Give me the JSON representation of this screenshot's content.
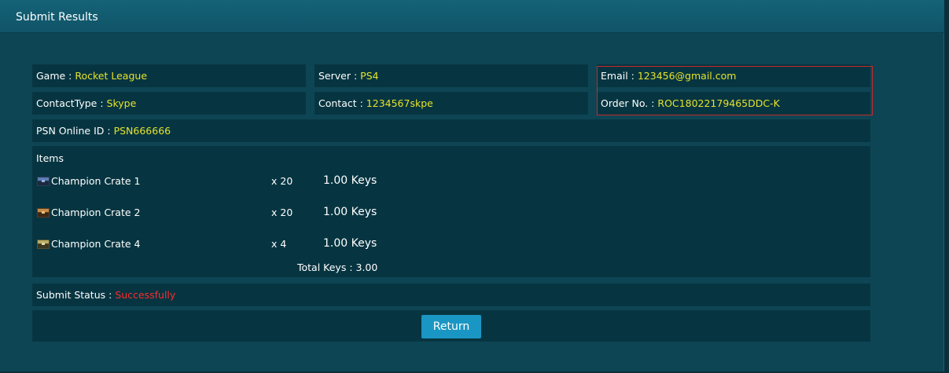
{
  "header": {
    "title": "Submit Results"
  },
  "fields": {
    "game": {
      "label": "Game : ",
      "value": "Rocket League"
    },
    "server": {
      "label": "Server : ",
      "value": "PS4"
    },
    "email": {
      "label": "Email : ",
      "value": "123456@gmail.com"
    },
    "contact_type": {
      "label": "ContactType : ",
      "value": "Skype"
    },
    "contact": {
      "label": "Contact : ",
      "value": "1234567skpe"
    },
    "order_no": {
      "label": "Order No. : ",
      "value": "ROC18022179465DDC-K"
    },
    "psn_id": {
      "label": "PSN Online ID : ",
      "value": "PSN666666"
    }
  },
  "items": {
    "title": "Items",
    "list": [
      {
        "name": "Champion Crate 1",
        "qty": "x 20",
        "price": "1.00 Keys",
        "icon": "crate-1-icon"
      },
      {
        "name": "Champion Crate 2",
        "qty": "x 20",
        "price": "1.00 Keys",
        "icon": "crate-2-icon"
      },
      {
        "name": "Champion Crate 4",
        "qty": "x 4",
        "price": "1.00 Keys",
        "icon": "crate-4-icon"
      }
    ],
    "total": "Total Keys : 3.00"
  },
  "status": {
    "label": "Submit Status : ",
    "value": "Successfully"
  },
  "actions": {
    "return_label": "Return"
  },
  "colors": {
    "value": "#e6e22c",
    "status": "#ff2a2a",
    "button": "#1a96c4",
    "highlight_border": "#c9292a"
  }
}
